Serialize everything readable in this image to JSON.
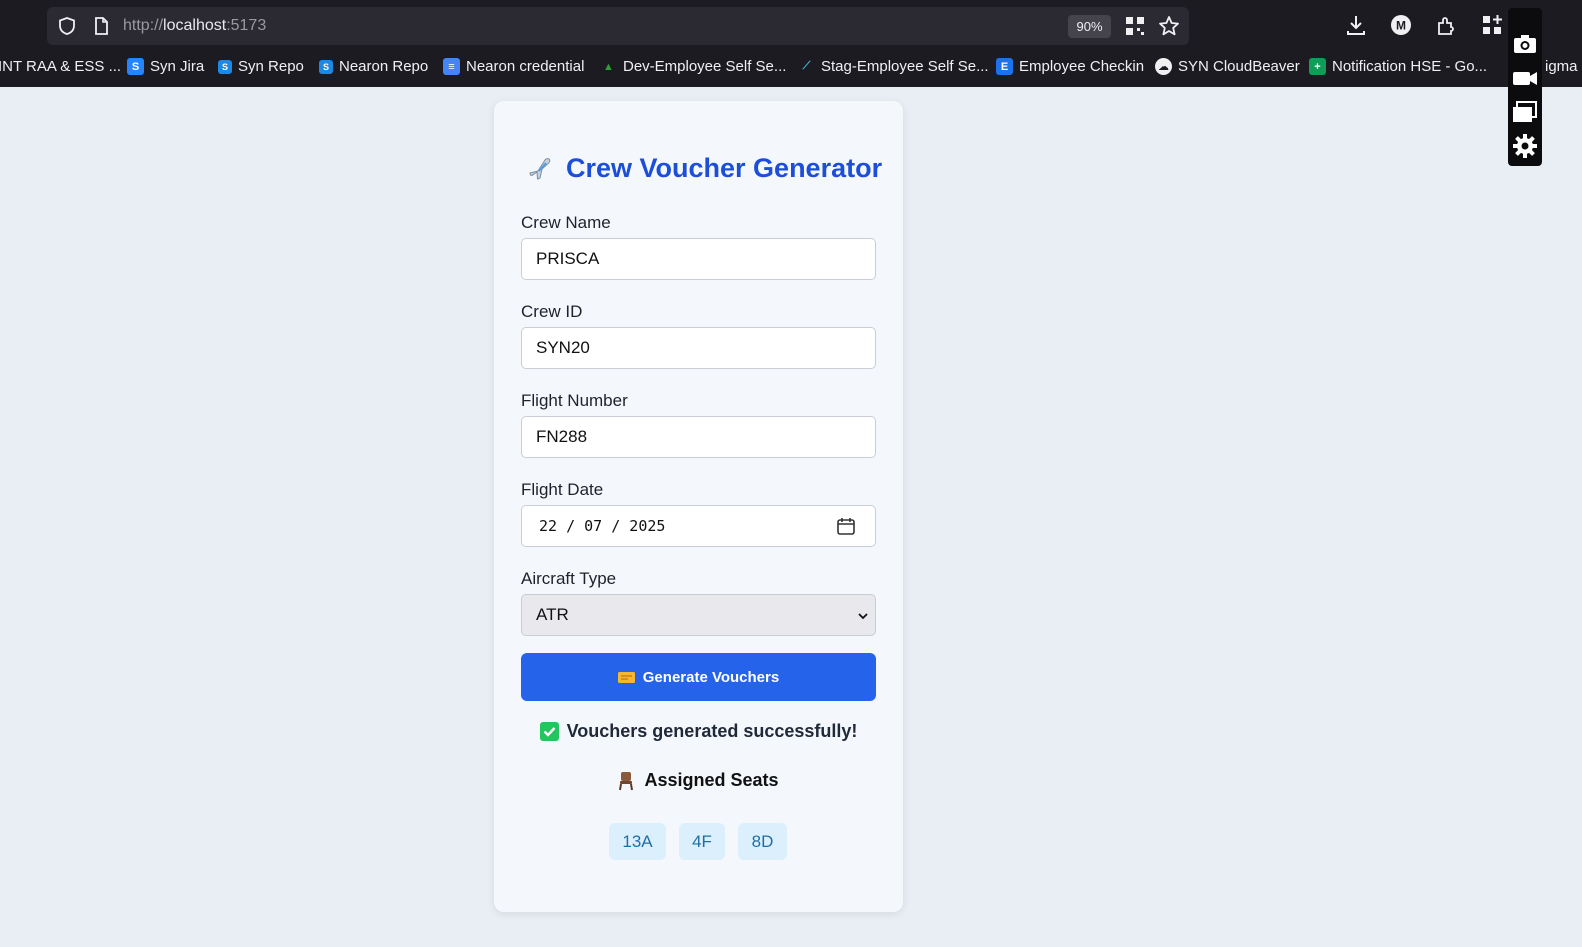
{
  "browser": {
    "url_scheme": "http://",
    "url_host": "localhost",
    "url_port": ":5173",
    "zoom": "90%",
    "bookmarks": [
      {
        "label": "INT RAA & ESS ...",
        "icon": "none"
      },
      {
        "label": "Syn Jira",
        "icon": "jira-icon"
      },
      {
        "label": "Syn Repo",
        "icon": "repo-icon"
      },
      {
        "label": "Nearon Repo",
        "icon": "repo-icon"
      },
      {
        "label": "Nearon credential",
        "icon": "docs-icon"
      },
      {
        "label": "Dev-Employee Self Se...",
        "icon": "ess-icon"
      },
      {
        "label": "Stag-Employee Self Se...",
        "icon": "ess-stag-icon"
      },
      {
        "label": "Employee Checkin",
        "icon": "checkin-icon"
      },
      {
        "label": "SYN CloudBeaver",
        "icon": "cloudbeaver-icon"
      },
      {
        "label": "Notification HSE - Go...",
        "icon": "sheets-icon"
      },
      {
        "label": "igma",
        "icon": "none"
      }
    ]
  },
  "app": {
    "title": "Crew Voucher Generator",
    "form": {
      "crew_name_label": "Crew Name",
      "crew_name_value": "PRISCA",
      "crew_id_label": "Crew ID",
      "crew_id_value": "SYN20",
      "flight_number_label": "Flight Number",
      "flight_number_value": "FN288",
      "flight_date_label": "Flight Date",
      "flight_date_value": "22 / 07 / 2025",
      "aircraft_type_label": "Aircraft Type",
      "aircraft_type_value": "ATR"
    },
    "generate_button": "Generate Vouchers",
    "success_message": "Vouchers generated successfully!",
    "assigned_seats_title": "Assigned Seats",
    "seats": [
      "13A",
      "4F",
      "8D"
    ]
  },
  "colors": {
    "accent": "#2563eb",
    "title": "#1d4ed8",
    "success": "#22c55e",
    "seat_bg": "#dceffc",
    "page_bg": "#e9edf4"
  }
}
